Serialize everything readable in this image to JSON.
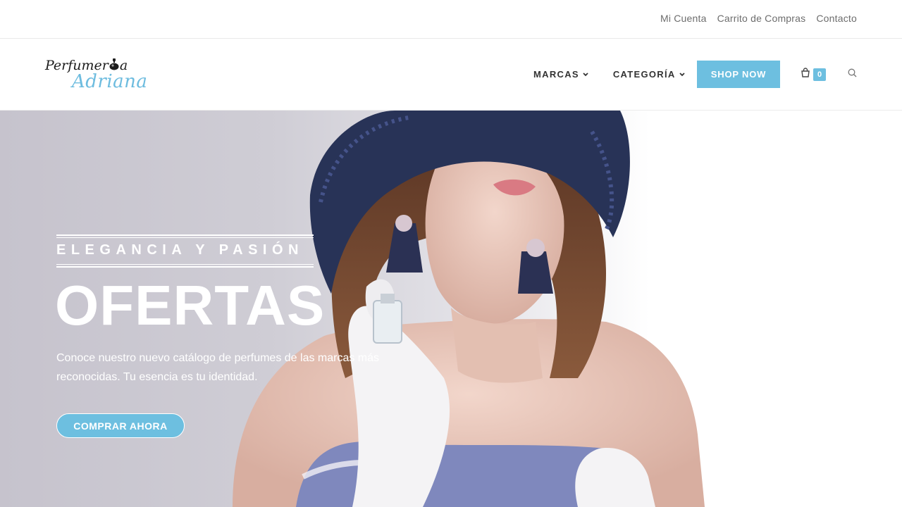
{
  "topbar": {
    "links": [
      "Mi Cuenta",
      "Carrito de Compras",
      "Contacto"
    ]
  },
  "logo": {
    "line1_a": "Perfumer",
    "line1_b": "a",
    "line2": "Adriana"
  },
  "nav": {
    "items": [
      {
        "label": "MARCAS",
        "icon": "chevron-down-icon"
      },
      {
        "label": "CATEGORÍA",
        "icon": "chevron-down-icon"
      }
    ],
    "shop_button": "SHOP NOW",
    "cart_count": "0",
    "icons": [
      "shopping-bag-icon",
      "search-icon"
    ]
  },
  "hero": {
    "tagline": "ELEGANCIA Y PASIÓN",
    "title": "OFERTAS",
    "text": "Conoce nuestro nuevo catálogo de perfumes de las marcas más reconocidas. Tu esencia es tu identidad.",
    "button": "COMPRAR AHORA"
  },
  "colors": {
    "accent": "#6dbfe0",
    "logo_blue": "#6dbcdf",
    "text_dark": "#333333",
    "topbar_text": "#6d6d6d"
  }
}
